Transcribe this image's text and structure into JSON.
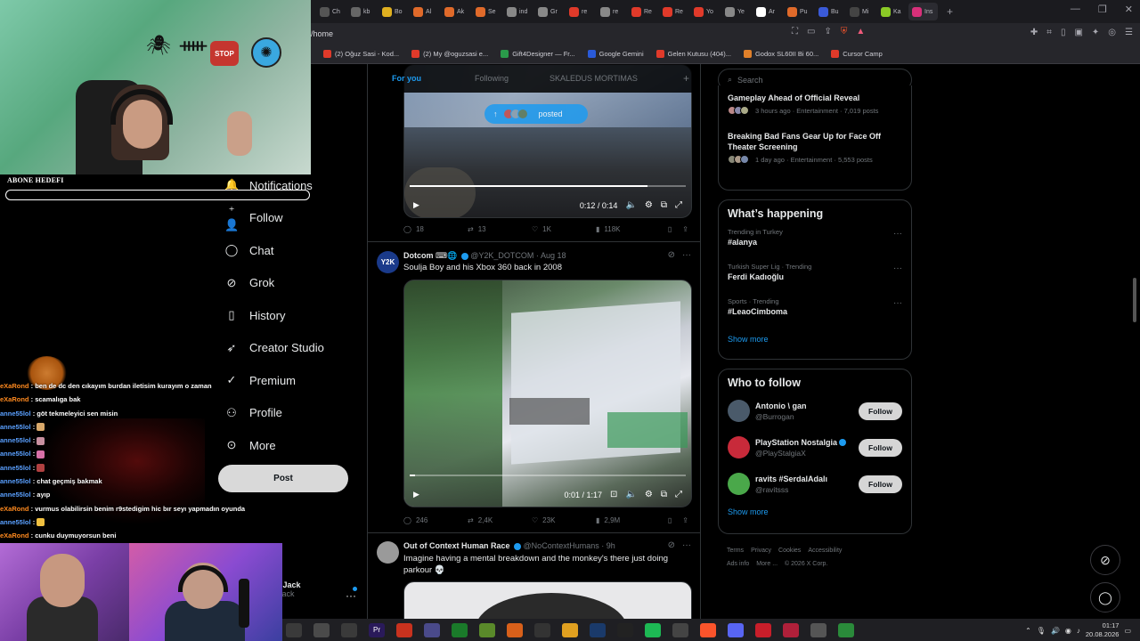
{
  "browser": {
    "tabs": [
      {
        "label": "Ch",
        "color": "#555555"
      },
      {
        "label": "kb",
        "color": "#666666"
      },
      {
        "label": "Bo",
        "color": "#e0b020"
      },
      {
        "label": "Al",
        "color": "#e06a2a"
      },
      {
        "label": "Ak",
        "color": "#e06a2a"
      },
      {
        "label": "Se",
        "color": "#e06a2a"
      },
      {
        "label": "ind",
        "color": "#888888"
      },
      {
        "label": "Gr",
        "color": "#888888"
      },
      {
        "label": "re",
        "color": "#e03a2a"
      },
      {
        "label": "re",
        "color": "#888888"
      },
      {
        "label": "Re",
        "color": "#e03a2a"
      },
      {
        "label": "Re",
        "color": "#e03a2a"
      },
      {
        "label": "Yo",
        "color": "#e03a2a"
      },
      {
        "label": "Ye",
        "color": "#888888"
      },
      {
        "label": "Ar",
        "color": "#ffffff"
      },
      {
        "label": "Pu",
        "color": "#e06a2a"
      },
      {
        "label": "Bu",
        "color": "#3a5ad8"
      },
      {
        "label": "Mi",
        "color": "#444444"
      },
      {
        "label": "Ka",
        "color": "#8ac926"
      },
      {
        "label": "Ins",
        "color": "#d8307a"
      }
    ],
    "url": "/home",
    "bookmarks": [
      {
        "label": "(2) Oğuz Sasi - Kod...",
        "color": "#e03a2a"
      },
      {
        "label": "(2) My @oguzsasi e...",
        "color": "#e03a2a"
      },
      {
        "label": "Gift4Designer — Fr...",
        "color": "#2a9a4a"
      },
      {
        "label": "Google Gemini",
        "color": "#2a5ad8"
      },
      {
        "label": "Gelen Kutusu (404)...",
        "color": "#e03a2a"
      },
      {
        "label": "Godox SL60II Bi 60...",
        "color": "#e0802a"
      },
      {
        "label": "Cursor Camp",
        "color": "#e03a2a"
      }
    ]
  },
  "nav": {
    "items": [
      {
        "label": "Notifications",
        "icon": "bell-icon"
      },
      {
        "label": "Follow",
        "icon": "person-plus-icon"
      },
      {
        "label": "Chat",
        "icon": "chat-icon"
      },
      {
        "label": "Grok",
        "icon": "grok-icon"
      },
      {
        "label": "History",
        "icon": "bookmark-icon"
      },
      {
        "label": "Creator Studio",
        "icon": "rocket-icon"
      },
      {
        "label": "Premium",
        "icon": "premium-icon"
      },
      {
        "label": "Profile",
        "icon": "person-icon"
      },
      {
        "label": "More",
        "icon": "more-circle-icon"
      }
    ],
    "post_label": "Post",
    "profile_name": "eye Jack",
    "profile_handle": "eyejack"
  },
  "feed": {
    "tabs": [
      "For you",
      "Following",
      "SKALEDUS MORTIMAS"
    ],
    "posted_label": "posted",
    "tweet1": {
      "time": "0:12 / 0:14",
      "progress": 0.86,
      "replies": "18",
      "reposts": "13",
      "likes": "1K",
      "views": "118K"
    },
    "tweet2": {
      "name": "Dotcom",
      "handle": "@Y2K_DOTCOM",
      "date": "Aug 18",
      "text": "Soulja Boy and his Xbox 360 back in 2008",
      "time": "0:01 / 1:17",
      "progress": 0.02,
      "replies": "246",
      "reposts": "2,4K",
      "likes": "23K",
      "views": "2,9M"
    },
    "tweet3": {
      "name": "Out of Context Human Race",
      "handle": "@NoContextHumans",
      "date": "9h",
      "text": "Imagine having a mental breakdown and the monkey's there just doing parkour 💀"
    }
  },
  "right": {
    "search_placeholder": "Search",
    "news": [
      {
        "title": "Gameplay Ahead of Official Reveal",
        "meta": "3 hours ago · Entertainment · 7,019 posts"
      },
      {
        "title": "Breaking Bad Fans Gear Up for Face Off Theater Screening",
        "meta": "1 day ago · Entertainment · 5,553 posts"
      }
    ],
    "happening_title": "What’s happening",
    "trends": [
      {
        "category": "Trending in Turkey",
        "name": "#alanya"
      },
      {
        "category": "Turkish Super Lig · Trending",
        "name": "Ferdi Kadıoğlu"
      },
      {
        "category": "Sports · Trending",
        "name": "#LeaoCimboma"
      }
    ],
    "show_more": "Show more",
    "wtf_title": "Who to follow",
    "follow_label": "Follow",
    "who_to_follow": [
      {
        "name": "Antonio \\ gan",
        "handle": "@Burrogan",
        "color": "#4a5a6a"
      },
      {
        "name": "PlayStation Nostalgia",
        "handle": "@PlayStalgiaX",
        "color": "#c82a3a"
      },
      {
        "name": "ravits #SerdalAdalı",
        "handle": "@ravitsss",
        "color": "#4aa84a"
      }
    ],
    "footer": [
      "Terms",
      "Privacy",
      "Cookies",
      "Accessibility",
      "Ads info",
      "More ...",
      "© 2026 X Corp."
    ]
  },
  "stream": {
    "goal_label": "ABONE HEDEFI",
    "goal_progress": 0,
    "chat": [
      {
        "user": "eXaRond",
        "c": "u1",
        "text": "ben de dc den cıkayım burdan iletisim kurayım o zaman"
      },
      {
        "user": "eXaRond",
        "c": "u1",
        "text": "scamalıga bak"
      },
      {
        "user": "anne55lol",
        "c": "u2",
        "text": "göt tekmeleyici sen misin"
      },
      {
        "user": "anne55lol",
        "c": "u2",
        "text": "",
        "emote": "#d8a86a"
      },
      {
        "user": "anne55lol",
        "c": "u2",
        "text": "",
        "emote": "#c890a0"
      },
      {
        "user": "anne55lol",
        "c": "u2",
        "text": "",
        "emote": "#d870a8"
      },
      {
        "user": "anne55lol",
        "c": "u2",
        "text": "",
        "emote": "#b04040"
      },
      {
        "user": "anne55lol",
        "c": "u2",
        "text": "chat geçmiş bakmak"
      },
      {
        "user": "anne55lol",
        "c": "u2",
        "text": "ayıp"
      },
      {
        "user": "eXaRond",
        "c": "u1",
        "text": "vurmus olabilirsin benim r9stedigim hic bır seyı yapmadın oyunda"
      },
      {
        "user": "anne55lol",
        "c": "u2",
        "text": "",
        "emote": "#f0c040"
      },
      {
        "user": "eXaRond",
        "c": "u1",
        "text": "cunku duymuyorsun beni"
      }
    ]
  },
  "taskbar": {
    "apps": [
      {
        "label": "",
        "color": "#3a3a3a"
      },
      {
        "label": "",
        "color": "#4a4a4a"
      },
      {
        "label": "",
        "color": "#3a3a3a"
      },
      {
        "label": "Pr",
        "color": "#2a1a5a"
      },
      {
        "label": "",
        "color": "#c8321e"
      },
      {
        "label": "",
        "color": "#4a4a8a"
      },
      {
        "label": "",
        "color": "#1a7a2a"
      },
      {
        "label": "",
        "color": "#5a8a2a"
      },
      {
        "label": "",
        "color": "#d8601a"
      },
      {
        "label": "",
        "color": "#333333"
      },
      {
        "label": "",
        "color": "#e0a020"
      },
      {
        "label": "",
        "color": "#1a3a6a"
      },
      {
        "label": "",
        "color": "#222222"
      },
      {
        "label": "",
        "color": "#1db954"
      },
      {
        "label": "",
        "color": "#444444"
      },
      {
        "label": "",
        "color": "#fb542b"
      },
      {
        "label": "",
        "color": "#5865f2"
      },
      {
        "label": "",
        "color": "#c81e2a"
      },
      {
        "label": "",
        "color": "#b0203a"
      },
      {
        "label": "",
        "color": "#555555"
      },
      {
        "label": "",
        "color": "#2a8a3a"
      }
    ],
    "time": "01:17",
    "date": "20.08.2026"
  },
  "colors": {
    "accent": "#1d9bf0",
    "bg": "#000000",
    "border": "#2f3336"
  }
}
